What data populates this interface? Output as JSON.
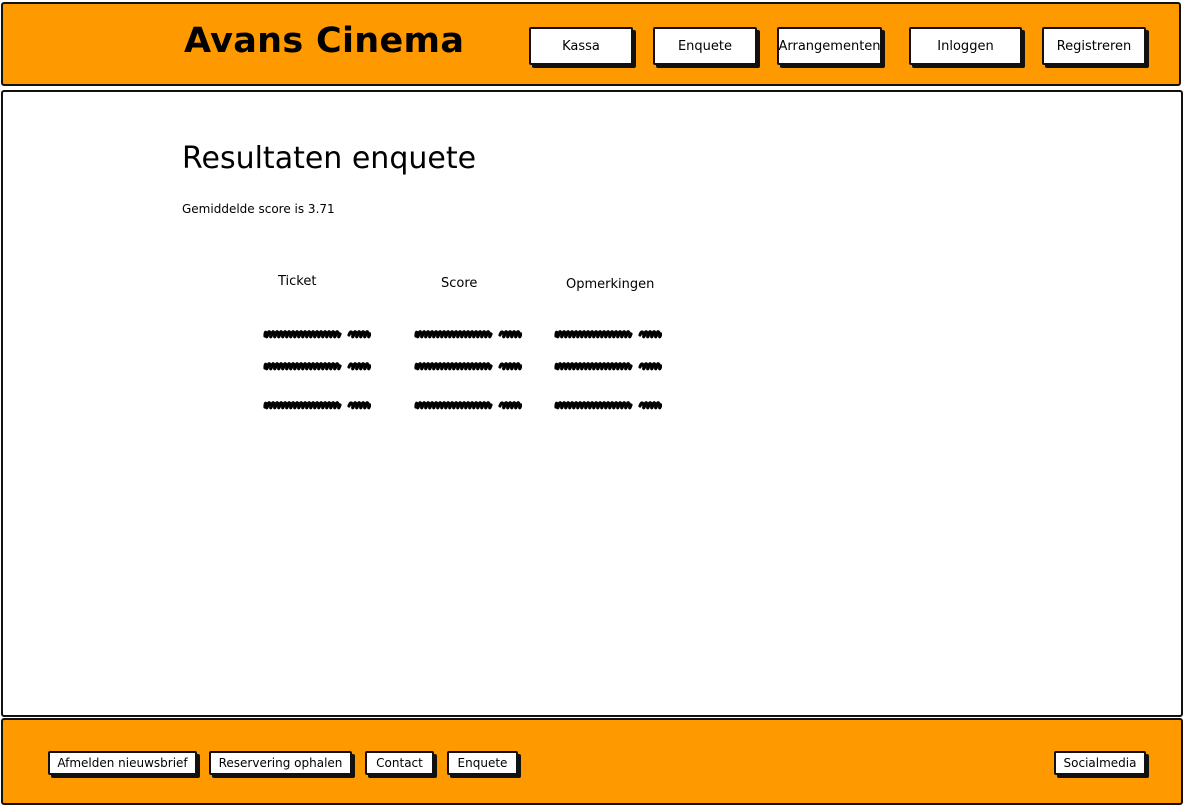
{
  "header": {
    "brand": "Avans Cinema",
    "nav": [
      {
        "label": "Kassa"
      },
      {
        "label": "Enquete"
      },
      {
        "label": "Arrangementen"
      },
      {
        "label": "Inloggen"
      },
      {
        "label": "Registreren"
      }
    ]
  },
  "main": {
    "title": "Resultaten enquete",
    "average_text": "Gemiddelde score is 3.71",
    "table": {
      "columns": [
        "Ticket",
        "Score",
        "Opmerkingen"
      ],
      "rows": 3,
      "cell_placeholder": "scribble"
    }
  },
  "footer": {
    "links": [
      {
        "label": "Afmelden nieuwsbrief"
      },
      {
        "label": "Reservering ophalen"
      },
      {
        "label": "Contact"
      },
      {
        "label": "Enquete"
      }
    ],
    "social": "Socialmedia"
  },
  "colors": {
    "accent": "#ff9900",
    "border": "#111111",
    "background": "#ffffff"
  }
}
